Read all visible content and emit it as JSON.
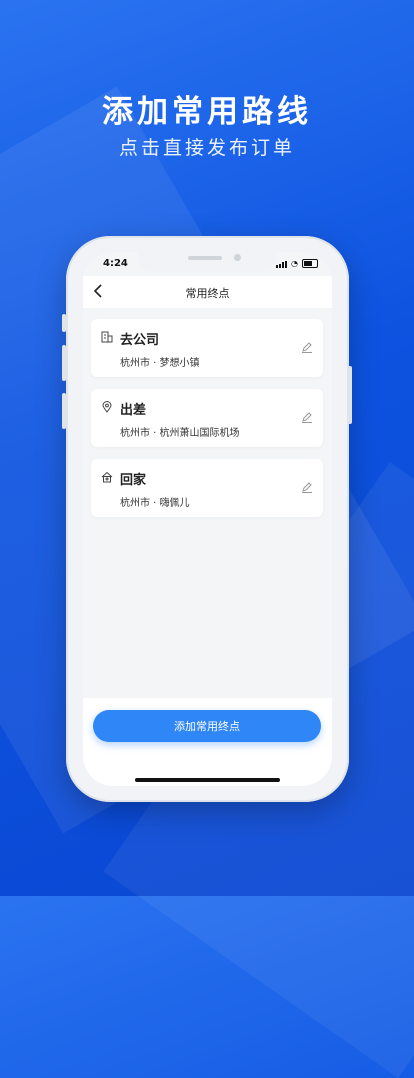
{
  "promo": {
    "headline": "添加常用路线",
    "subline": "点击直接发布订单"
  },
  "status_bar": {
    "time": "4:24"
  },
  "navbar": {
    "title": "常用终点",
    "back_icon": "chevron-left-icon"
  },
  "destinations": [
    {
      "title": "去公司",
      "address": "杭州市 · 梦想小镇",
      "icon": "building-icon"
    },
    {
      "title": "出差",
      "address": "杭州市 · 杭州萧山国际机场",
      "icon": "location-pin-icon"
    },
    {
      "title": "回家",
      "address": "杭州市 · 嗨佩儿",
      "icon": "home-icon"
    }
  ],
  "add_button": {
    "label": "添加常用终点"
  },
  "colors": {
    "background": "#0d53e0",
    "accent": "#2f86f6"
  }
}
